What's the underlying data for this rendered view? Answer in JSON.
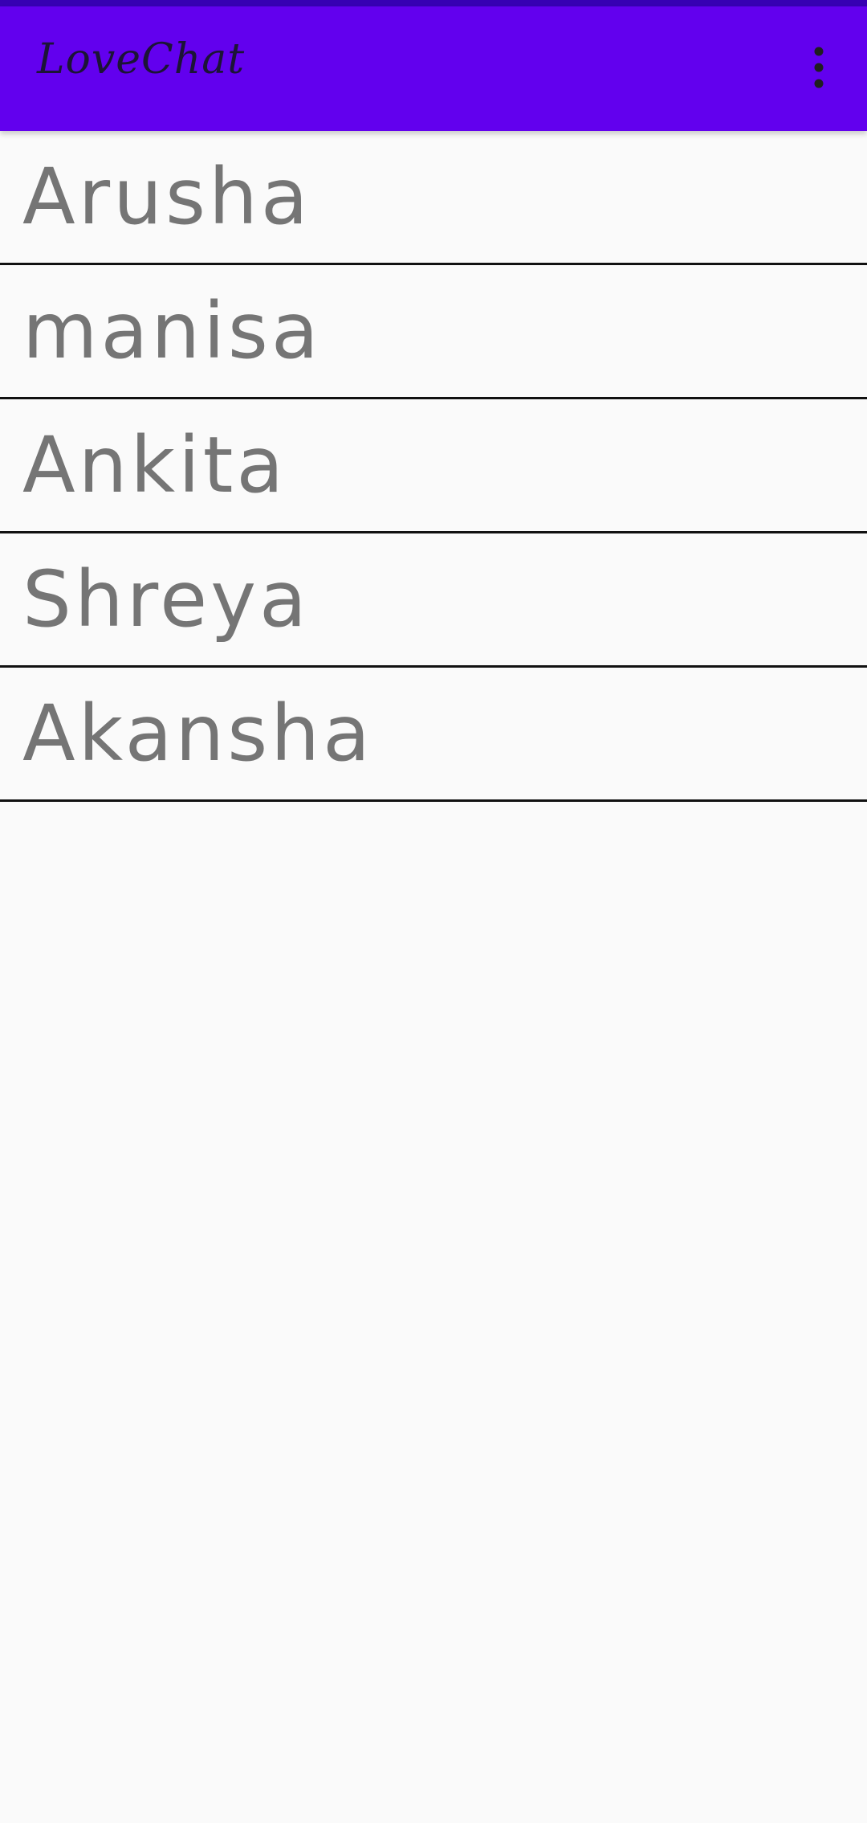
{
  "app_bar": {
    "title": "LoveChat",
    "overflow_icon": "more-vert-icon",
    "background_color": "#6200ee",
    "status_color": "#3700b3"
  },
  "contacts": [
    {
      "name": "Arusha"
    },
    {
      "name": "manisa"
    },
    {
      "name": "Ankita"
    },
    {
      "name": "Shreya"
    },
    {
      "name": "Akansha"
    }
  ],
  "colors": {
    "name_text": "#757575",
    "divider": "#111111",
    "background": "#fafafa"
  }
}
